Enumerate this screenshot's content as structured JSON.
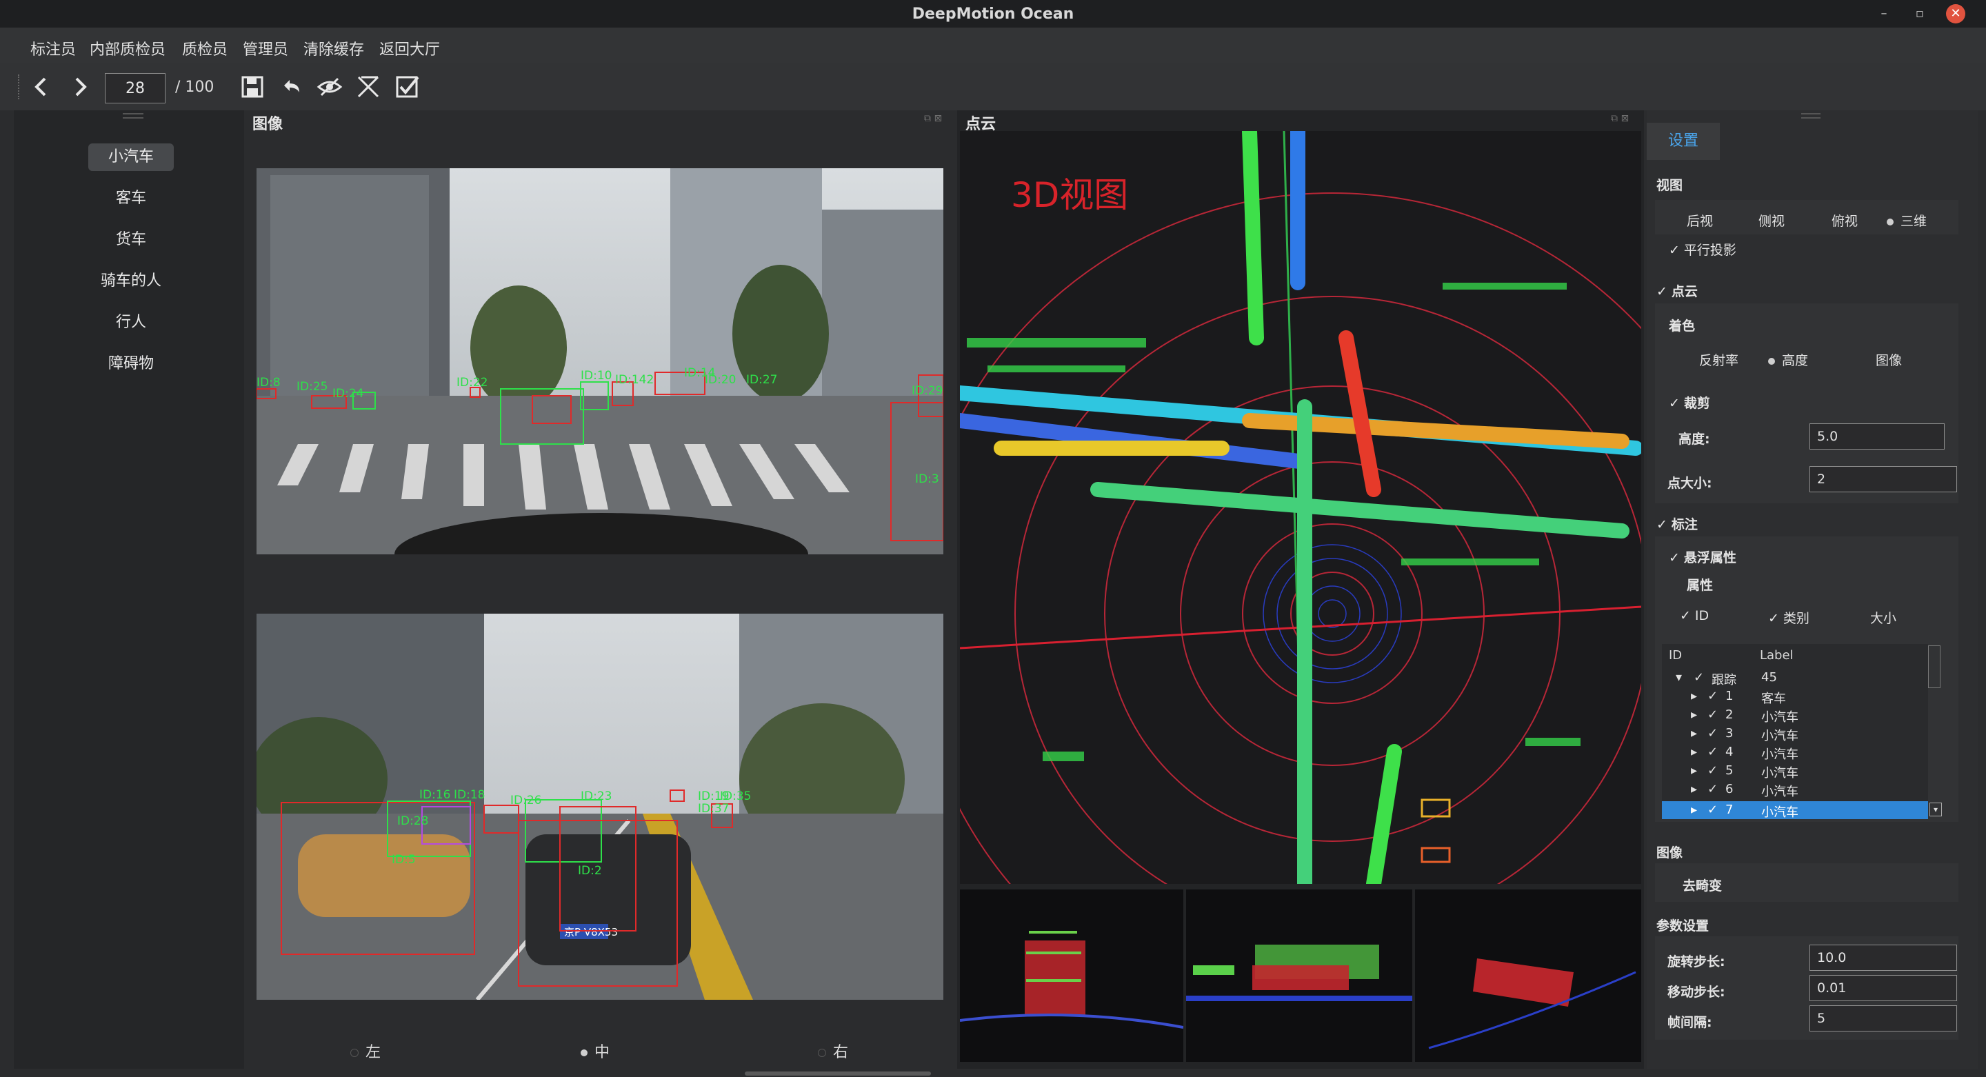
{
  "window": {
    "title": "DeepMotion Ocean",
    "controls": [
      "–",
      "▫",
      "✕"
    ],
    "close_color": "#e1533f"
  },
  "menu": [
    "标注员",
    "内部质检员",
    "质检员",
    "管理员",
    "清除缓存",
    "返回大厅"
  ],
  "toolbar": {
    "frame_value": "28",
    "frame_total": "/ 100",
    "icons": [
      "prev-icon",
      "next-icon",
      "save-icon",
      "undo-icon",
      "hide-icon",
      "tool-icon",
      "check-icon"
    ]
  },
  "categories": {
    "items": [
      "小汽车",
      "客车",
      "货车",
      "骑车的人",
      "行人",
      "障碍物"
    ],
    "selected": "小汽车"
  },
  "image_panel": {
    "title": "图像",
    "top_labels": [
      "ID:8",
      "ID:25",
      "ID:24",
      "ID:22",
      "ID:10",
      "ID:142",
      "ID:14",
      "ID:20",
      "ID:27",
      "ID:29",
      "ID:3"
    ],
    "bottom_labels": [
      "ID:16",
      "ID:18",
      "ID:28",
      "ID:5",
      "ID:26",
      "ID:23",
      "ID:2",
      "ID:37",
      "ID:19",
      "ID:35"
    ],
    "plate_front": "京P V8X53",
    "view_options": [
      "左",
      "中",
      "右"
    ],
    "view_selected": "中",
    "box_green": "#2ee04a",
    "box_red": "#e02a2a"
  },
  "pointcloud_panel": {
    "title": "点云",
    "overlay_text": "3D视图",
    "overlay_color": "#d8232a"
  },
  "settings": {
    "tab": "设置",
    "view_section": "视图",
    "view_options": [
      "后视",
      "侧视",
      "俯视",
      "三维"
    ],
    "view_selected": "三维",
    "parallel_projection": "平行投影",
    "pointcloud_section": "点云",
    "coloring_label": "着色",
    "coloring_options": [
      "反射率",
      "高度",
      "图像"
    ],
    "coloring_selected": "高度",
    "crop_label": "裁剪",
    "height_label": "高度:",
    "height_value": "5.0",
    "point_size_label": "点大小:",
    "point_size_value": "2",
    "annotation_section": "标注",
    "float_attr_label": "悬浮属性",
    "attr_label": "属性",
    "attr_options": [
      "ID",
      "类别",
      "大小"
    ],
    "tree": {
      "columns": [
        "ID",
        "Label"
      ],
      "root": {
        "id": "跟踪",
        "label": "45"
      },
      "rows": [
        {
          "id": "1",
          "label": "客车"
        },
        {
          "id": "2",
          "label": "小汽车"
        },
        {
          "id": "3",
          "label": "小汽车"
        },
        {
          "id": "4",
          "label": "小汽车"
        },
        {
          "id": "5",
          "label": "小汽车"
        },
        {
          "id": "6",
          "label": "小汽车"
        },
        {
          "id": "7",
          "label": "小汽车"
        }
      ],
      "selected_index": 6
    },
    "image_section": "图像",
    "undistort_label": "去畸变",
    "params_section": "参数设置",
    "rotate_step_label": "旋转步长:",
    "rotate_step_value": "10.0",
    "move_step_label": "移动步长:",
    "move_step_value": "0.01",
    "frame_interval_label": "帧间隔:",
    "frame_interval_value": "5",
    "accent_color": "#2f86d6"
  }
}
